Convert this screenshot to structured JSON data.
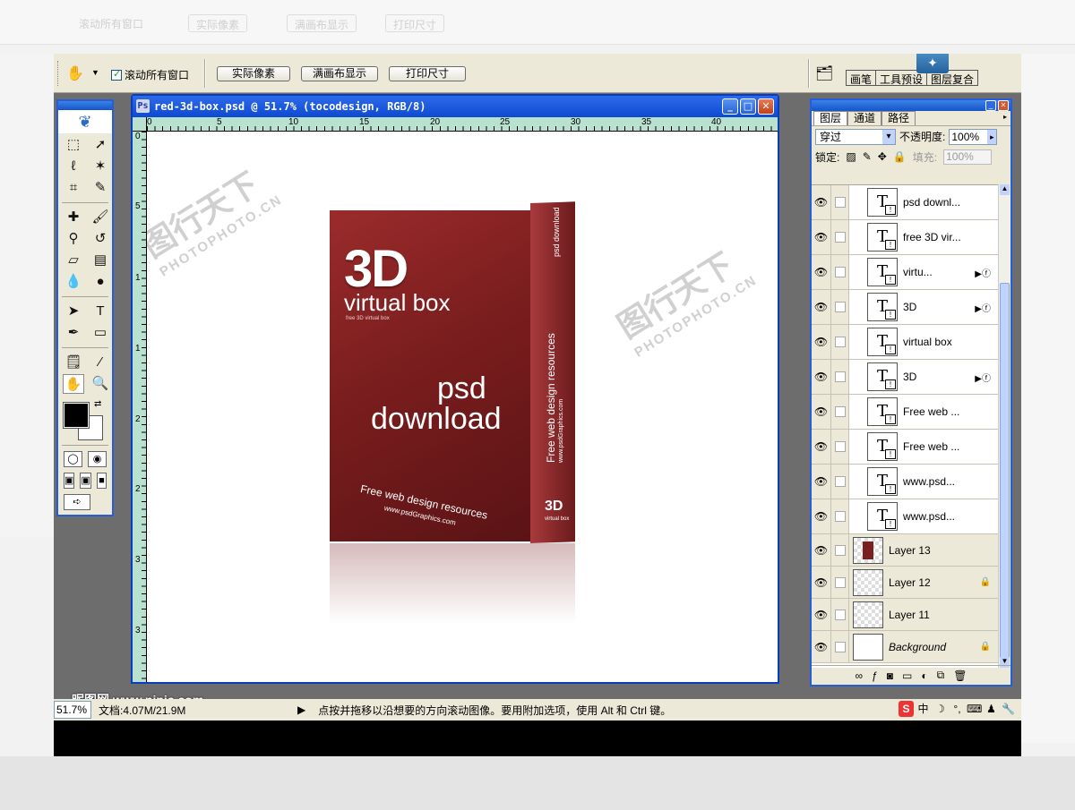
{
  "background": {
    "ghost_buttons": [
      "实际像素",
      "满画布显示",
      "打印尺寸"
    ],
    "ghost_checkbox": "滚动所有窗口"
  },
  "options_bar": {
    "scroll_all_label": "滚动所有窗口",
    "buttons": [
      "实际像素",
      "满画布显示",
      "打印尺寸"
    ],
    "palette_tabs": [
      "画笔",
      "工具预设",
      "图层复合"
    ]
  },
  "document": {
    "title": "red-3d-box.psd @ 51.7% (tocodesign, RGB/8)",
    "ruler_top": [
      "0",
      "5",
      "10",
      "15",
      "20",
      "25",
      "30",
      "35",
      "40"
    ],
    "ruler_left": [
      "0",
      "5",
      "1",
      "1",
      "2",
      "2",
      "3",
      "3"
    ]
  },
  "artwork": {
    "big_3d": "3D",
    "virtual_box": "virtual box",
    "tagline": "free 3D virtual box",
    "psd": "psd",
    "download": "download",
    "free_web": "Free web design resources",
    "url": "www.psdGraphics.com",
    "side_title": "Free web design resources",
    "side_url": "www.psdGraphics.com",
    "side_top": "psd download",
    "side_3d": "3D",
    "side_vb": "virtual box",
    "watermark_cn": "图行天下",
    "watermark_en": "PHOTOPHOTO.CN"
  },
  "layers_panel": {
    "tabs": [
      "图层",
      "通道",
      "路径"
    ],
    "blend_mode": "穿过",
    "opacity_label": "不透明度:",
    "opacity_value": "100%",
    "lock_label": "锁定:",
    "fill_label": "填充:",
    "fill_value": "100%",
    "layers": [
      {
        "name": "psd downl...",
        "type": "text",
        "fx": false
      },
      {
        "name": "free 3D vir...",
        "type": "text",
        "fx": false
      },
      {
        "name": "virtu...",
        "type": "text",
        "fx": true
      },
      {
        "name": "3D",
        "type": "text",
        "fx": true
      },
      {
        "name": "virtual box",
        "type": "text",
        "fx": false
      },
      {
        "name": "3D",
        "type": "text",
        "fx": true
      },
      {
        "name": "Free web ...",
        "type": "text",
        "fx": false
      },
      {
        "name": "Free web ...",
        "type": "text",
        "fx": false
      },
      {
        "name": "www.psd...",
        "type": "text",
        "fx": false
      },
      {
        "name": "www.psd...",
        "type": "text",
        "fx": false
      },
      {
        "name": "Layer 13",
        "type": "pixel",
        "locked": false
      },
      {
        "name": "Layer 12",
        "type": "pixel",
        "locked": true
      },
      {
        "name": "Layer 11",
        "type": "pixel",
        "locked": false
      },
      {
        "name": "Background",
        "type": "pixel",
        "locked": true
      }
    ]
  },
  "status_bar": {
    "zoom": "51.7%",
    "doc_size": "文档:4.07M/21.9M",
    "message": "点按并拖移以沿想要的方向滚动图像。要用附加选项，使用 Alt 和 Ctrl 键。",
    "ime": [
      "S",
      "中",
      "☽",
      "°,",
      "⌨",
      "♟",
      "🔧"
    ]
  },
  "site_watermark": "昵图网 www.nipic.com",
  "colors": {
    "title_blue": "#0e49d1",
    "panel_bg": "#ece9d8",
    "box_red": "#7a1d1e"
  }
}
